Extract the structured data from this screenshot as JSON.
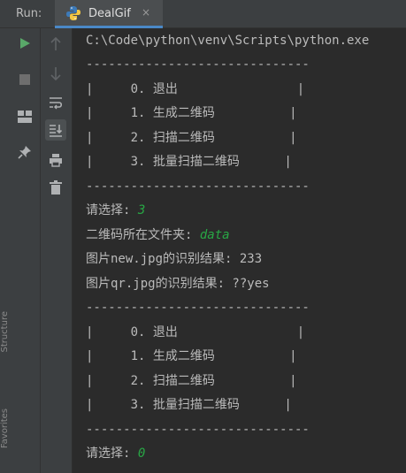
{
  "header": {
    "run_label": "Run:",
    "tab_label": "DealGif",
    "tab_close": "×"
  },
  "side_panel": {
    "structure_label": "Structure",
    "favorites_label": "Favorites"
  },
  "console": {
    "lines": [
      {
        "text": "C:\\Code\\python\\venv\\Scripts\\python.exe",
        "input": ""
      },
      {
        "text": "------------------------------",
        "input": ""
      },
      {
        "text": "|     0. 退出                |",
        "input": ""
      },
      {
        "text": "|     1. 生成二维码          |",
        "input": ""
      },
      {
        "text": "|     2. 扫描二维码          |",
        "input": ""
      },
      {
        "text": "|     3. 批量扫描二维码      |",
        "input": ""
      },
      {
        "text": "------------------------------",
        "input": ""
      },
      {
        "text": "请选择: ",
        "input": "3"
      },
      {
        "text": "二维码所在文件夹: ",
        "input": "data"
      },
      {
        "text": "图片new.jpg的识别结果: 233",
        "input": ""
      },
      {
        "text": "图片qr.jpg的识别结果: ??yes",
        "input": ""
      },
      {
        "text": "------------------------------",
        "input": ""
      },
      {
        "text": "|     0. 退出                |",
        "input": ""
      },
      {
        "text": "|     1. 生成二维码          |",
        "input": ""
      },
      {
        "text": "|     2. 扫描二维码          |",
        "input": ""
      },
      {
        "text": "|     3. 批量扫描二维码      |",
        "input": ""
      },
      {
        "text": "------------------------------",
        "input": ""
      },
      {
        "text": "请选择: ",
        "input": "0"
      }
    ]
  },
  "colors": {
    "background": "#2b2b2b",
    "toolbar": "#3c3f41",
    "text": "#bbbbbb",
    "input_text": "#28a745",
    "run_green": "#59a869",
    "tab_accent": "#4a88c7"
  },
  "icons": {
    "run": "play-icon",
    "stop": "stop-icon",
    "layout": "layout-icon",
    "pin": "pin-icon",
    "up": "arrow-up-icon",
    "down": "arrow-down-icon",
    "wrap": "soft-wrap-icon",
    "scroll_end": "scroll-to-end-icon",
    "print": "print-icon",
    "delete": "trash-icon",
    "python": "python-icon"
  }
}
